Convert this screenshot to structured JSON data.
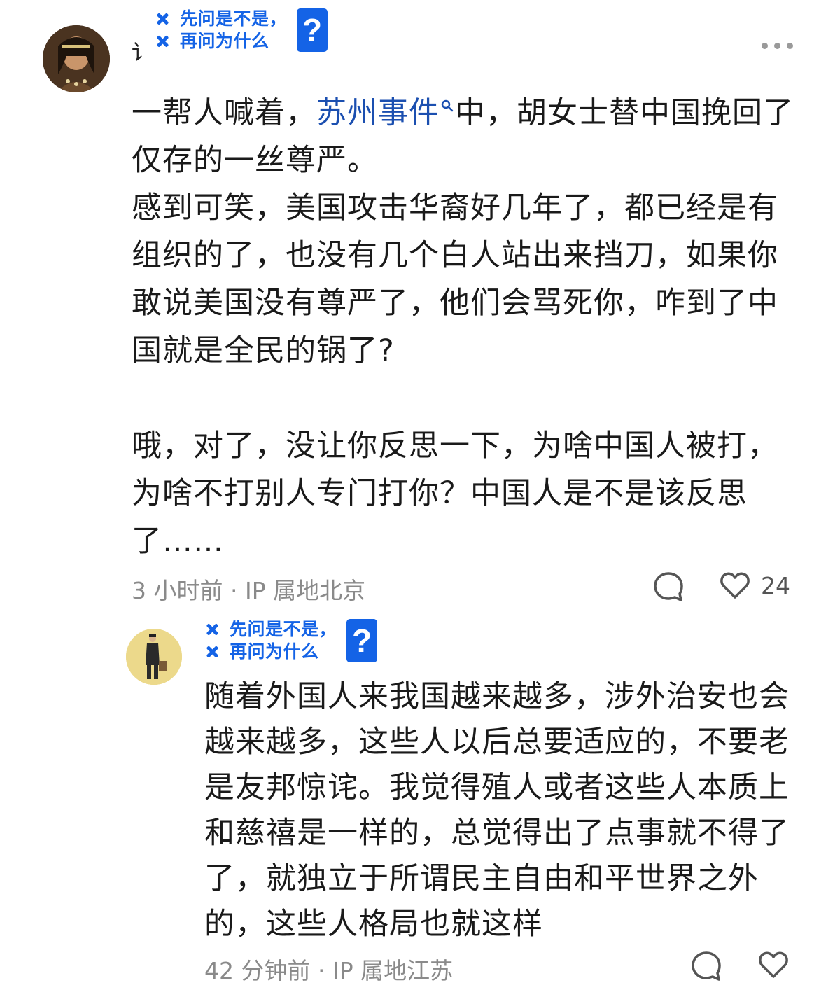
{
  "comments": [
    {
      "name_fragment": "讠",
      "badge": {
        "line1": "先问是不是，",
        "line2": "再问为什么",
        "q": "?"
      },
      "text_before_link": "一帮人喊着，",
      "link_text": "苏州事件",
      "text_after_link": "中，胡女士替中国挽回了仅存的一丝尊严。",
      "paragraph2": "感到可笑，美国攻击华裔好几年了，都已经是有组织的了，也没有几个白人站出来挡刀，如果你敢说美国没有尊严了，他们会骂死你，咋到了中国就是全民的锅了?",
      "paragraph3": "哦，对了，没让你反思一下，为啥中国人被打，为啥不打别人专门打你？中国人是不是该反思了……",
      "time": "3 小时前",
      "ip": "IP 属地北京",
      "like_count": "24"
    },
    {
      "badge": {
        "line1": "先问是不是，",
        "line2": "再问为什么",
        "q": "?"
      },
      "text": "随着外国人来我国越来越多，涉外治安也会越来越多，这些人以后总要适应的，不要老是友邦惊诧。我觉得殖人或者这些人本质上和慈禧是一样的，总觉得出了点事就不得了了，就独立于所谓民主自由和平世界之外的，这些人格局也就这样",
      "time": "42 分钟前",
      "ip": "IP 属地江苏"
    }
  ],
  "icons": [
    "more-options-icon",
    "comment-bubble-icon",
    "heart-icon",
    "search-icon",
    "close-x-icon",
    "question-mark-icon"
  ],
  "colors": {
    "link": "#1b4fb0",
    "badge": "#1463e6",
    "meta": "#8a8a8a"
  }
}
